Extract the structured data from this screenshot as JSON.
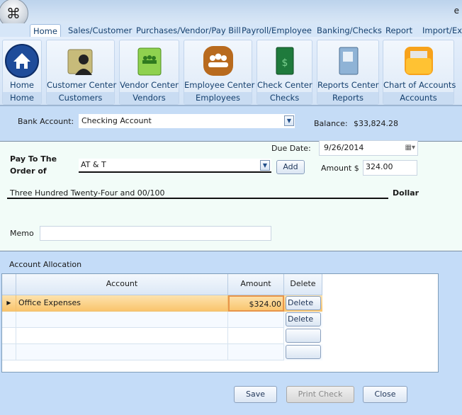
{
  "window": {
    "title_fragment": "e"
  },
  "tabs": [
    {
      "label": "Home",
      "selected": true
    },
    {
      "label": "Sales/Customer"
    },
    {
      "label": "Purchases/Vendor/Pay Bill"
    },
    {
      "label": "Payroll/Employee"
    },
    {
      "label": "Banking/Checks"
    },
    {
      "label": "Report"
    },
    {
      "label": "Import/Exp"
    }
  ],
  "ribbon": [
    {
      "label": "Home",
      "group": "Home",
      "icon": "home-icon"
    },
    {
      "label": "Customer Center",
      "group": "Customers",
      "icon": "customer-folder-icon"
    },
    {
      "label": "Vendor Center",
      "group": "Vendors",
      "icon": "vendor-book-icon"
    },
    {
      "label": "Employee Center",
      "group": "Employees",
      "icon": "employees-icon"
    },
    {
      "label": "Check Center",
      "group": "Checks",
      "icon": "checkbook-icon"
    },
    {
      "label": "Reports Center",
      "group": "Reports",
      "icon": "reports-binder-icon"
    },
    {
      "label": "Chart of Accounts",
      "group": "Accounts",
      "icon": "accounts-folder-icon"
    }
  ],
  "bank": {
    "label": "Bank Account:",
    "value": "Checking Account",
    "balance_label": "Balance:",
    "balance": "$33,824.28"
  },
  "check": {
    "pay_to_line1": "Pay To The",
    "pay_to_line2": "Order of",
    "payee": "AT & T",
    "add_label": "Add",
    "due_date_label": "Due Date:",
    "due_date": "9/26/2014",
    "amount_label": "Amount $",
    "amount": "324.00",
    "amount_words": "Three Hundred Twenty-Four and 00/100",
    "dollar_label": "Dollar",
    "memo_label": "Memo",
    "memo": ""
  },
  "allocation": {
    "title": "Account Allocation",
    "columns": [
      "Account",
      "Amount",
      "Delete"
    ],
    "rows": [
      {
        "account": "Office Expenses",
        "amount": "$324.00",
        "delete": "Delete",
        "selected": true
      },
      {
        "account": "",
        "amount": "",
        "delete": "Delete"
      },
      {
        "account": "",
        "amount": "",
        "delete": ""
      },
      {
        "account": "",
        "amount": "",
        "delete": ""
      }
    ]
  },
  "buttons": {
    "save": "Save",
    "print": "Print Check",
    "close": "Close"
  },
  "colors": {
    "selected_row": "#fbd58f",
    "panel": "#c5dcf6",
    "check_bg": "#f2fcf8"
  }
}
